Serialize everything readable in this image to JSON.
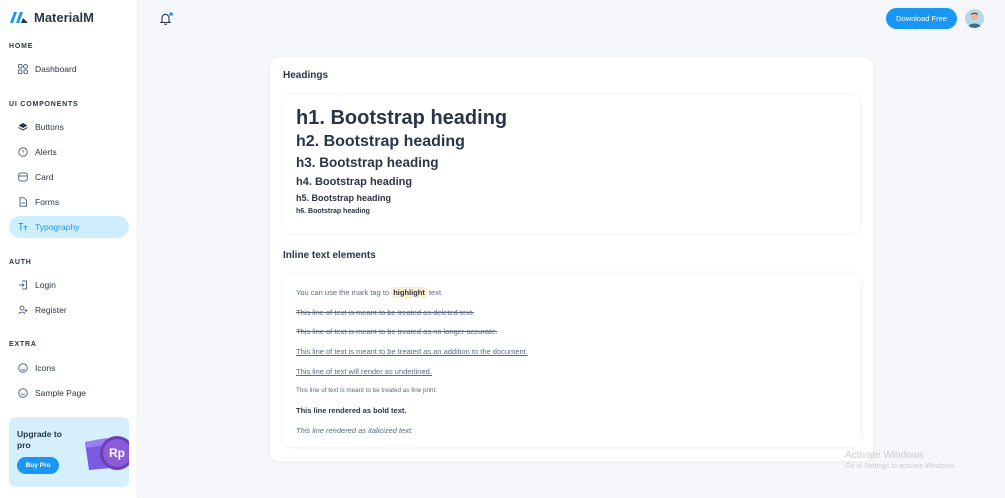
{
  "brand": {
    "name": "MaterialM"
  },
  "sidebar": {
    "sections": {
      "home": "HOME",
      "ui": "UI COMPONENTS",
      "auth": "AUTH",
      "extra": "EXTRA"
    },
    "items": {
      "dashboard": "Dashboard",
      "buttons": "Buttons",
      "alerts": "Alerts",
      "card": "Card",
      "forms": "Forms",
      "typography": "Typography",
      "login": "Login",
      "register": "Register",
      "icons": "Icons",
      "sample_page": "Sample Page"
    },
    "active_item": "typography"
  },
  "upgrade": {
    "title": "Upgrade to pro",
    "button": "Buy Pro",
    "badge": "Rp"
  },
  "header": {
    "download_button": "Download Free"
  },
  "headings_card": {
    "title": "Headings",
    "h1": "h1. Bootstrap heading",
    "h2": "h2. Bootstrap heading",
    "h3": "h3. Bootstrap heading",
    "h4": "h4. Bootstrap heading",
    "h5": "h5. Bootstrap heading",
    "h6": "h6. Bootstrap heading"
  },
  "inline_card": {
    "title": "Inline text elements",
    "mark_prefix": "You can use the mark tag to ",
    "mark_word": "highlight",
    "mark_suffix": " text.",
    "deleted": "This line of text is meant to be treated as deleted text.",
    "no_longer": "This line of text is meant to be treated as no longer accurate.",
    "addition": "This line of text is meant to be treated as an addition to the document.",
    "underlined": "This line of text will render as underlined.",
    "fine_print": "This line of text is meant to be treated as fine print.",
    "bold": "This line rendered as bold text.",
    "italic": "This line rendered as italicized text."
  },
  "watermark": {
    "title": "Activate Windows",
    "subtitle": "Go to Settings to activate Windows."
  },
  "colors": {
    "primary": "#1a97f5",
    "active_bg": "#cfeefc",
    "text": "#2a3547"
  }
}
